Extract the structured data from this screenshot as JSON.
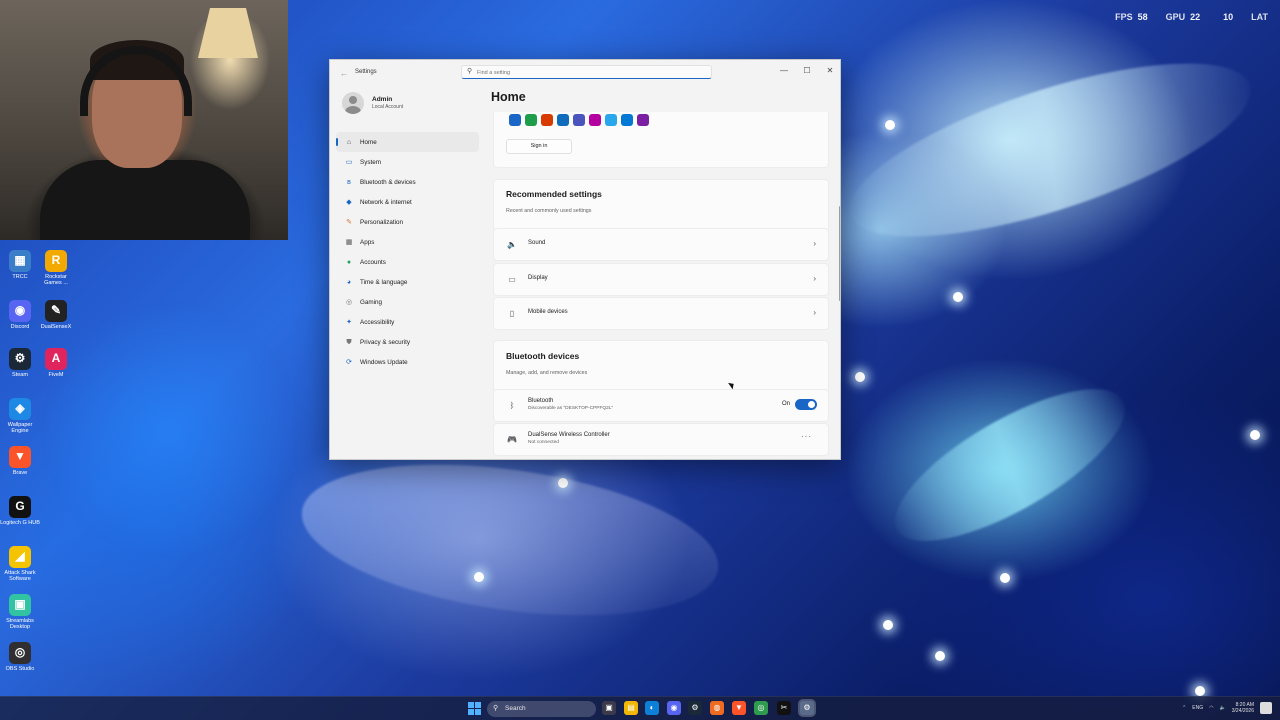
{
  "osd": {
    "fps_label": "FPS",
    "fps_value": "58",
    "gpu_label": "GPU",
    "gpu_value": "22",
    "cpu_value": "10",
    "lat_label": "LAT"
  },
  "desktop_icons": [
    {
      "name": "TRCC",
      "label": "TRCC",
      "color": "#3a7ec9",
      "glyph": "▦"
    },
    {
      "name": "rockstar",
      "label": "Rockstar Games ...",
      "color": "#f2a900",
      "glyph": "R"
    },
    {
      "name": "discord",
      "label": "Discord",
      "color": "#5865f2",
      "glyph": "◉"
    },
    {
      "name": "dualsensex",
      "label": "DualSenseX",
      "color": "#222222",
      "glyph": "✎"
    },
    {
      "name": "steam",
      "label": "Steam",
      "color": "#1b2838",
      "glyph": "⚙"
    },
    {
      "name": "fivem",
      "label": "FiveM",
      "color": "#e0245e",
      "glyph": "A"
    },
    {
      "name": "wallpaper-engine",
      "label": "Wallpaper Engine",
      "color": "#1e88e5",
      "glyph": "◈"
    },
    {
      "name": "brave",
      "label": "Brave",
      "color": "#fb542b",
      "glyph": "▼"
    },
    {
      "name": "logitech",
      "label": "Logitech G HUB",
      "color": "#111111",
      "glyph": "G"
    },
    {
      "name": "attack-shark",
      "label": "Attack Shark Software",
      "color": "#f5c400",
      "glyph": "◢"
    },
    {
      "name": "streamlabs",
      "label": "Streamlabs Desktop",
      "color": "#31c3a2",
      "glyph": "▣"
    },
    {
      "name": "obs",
      "label": "OBS Studio",
      "color": "#302e31",
      "glyph": "◎"
    }
  ],
  "window": {
    "app_title": "Settings",
    "search_placeholder": "Find a setting",
    "controls": {
      "minimize": "—",
      "maximize": "☐",
      "close": "✕"
    },
    "back": "←"
  },
  "profile": {
    "name": "Admin",
    "sub": "Local Account"
  },
  "nav": [
    {
      "label": "Home",
      "icon": "⌂",
      "color": "#444444",
      "active": true
    },
    {
      "label": "System",
      "icon": "▭",
      "color": "#1a66c6"
    },
    {
      "label": "Bluetooth & devices",
      "icon": "ʙ",
      "color": "#1a66c6"
    },
    {
      "label": "Network & internet",
      "icon": "◆",
      "color": "#1a66c6"
    },
    {
      "label": "Personalization",
      "icon": "✎",
      "color": "#d9702f"
    },
    {
      "label": "Apps",
      "icon": "▦",
      "color": "#555555"
    },
    {
      "label": "Accounts",
      "icon": "●",
      "color": "#2aa05a"
    },
    {
      "label": "Time & language",
      "icon": "◕",
      "color": "#1a66c6"
    },
    {
      "label": "Gaming",
      "icon": "◎",
      "color": "#777777"
    },
    {
      "label": "Accessibility",
      "icon": "✦",
      "color": "#1a66c6"
    },
    {
      "label": "Privacy & security",
      "icon": "⛊",
      "color": "#777777"
    },
    {
      "label": "Windows Update",
      "icon": "⟳",
      "color": "#1a66c6"
    }
  ],
  "main": {
    "title": "Home",
    "app_icon_colors": [
      "#1a66c6",
      "#1e9e4a",
      "#d83b01",
      "#0f6cbd",
      "#4b53bc",
      "#b4009e",
      "#28a8ea",
      "#0078d4",
      "#7b1fa2"
    ],
    "signin_label": "Sign in",
    "recommended": {
      "title": "Recommended settings",
      "sub": "Recent and commonly used settings",
      "items": [
        {
          "label": "Sound",
          "icon": "🔈"
        },
        {
          "label": "Display",
          "icon": "▭"
        },
        {
          "label": "Mobile devices",
          "icon": "▯"
        }
      ],
      "chevron": "›"
    },
    "bluetooth": {
      "title": "Bluetooth devices",
      "sub": "Manage, add, and remove devices",
      "bt_label": "Bluetooth",
      "bt_sub": "Discoverable as \"DESKTOP-CPPFQ2L\"",
      "bt_state": "On",
      "device_label": "DualSense Wireless Controller",
      "device_sub": "Not connected",
      "more": "···"
    }
  },
  "taskbar": {
    "search_label": "Search",
    "apps": [
      {
        "name": "task-view",
        "glyph": "▣",
        "color": "#3a3a4a"
      },
      {
        "name": "file-explorer",
        "glyph": "▤",
        "color": "#f2b705"
      },
      {
        "name": "edge",
        "glyph": "◐",
        "color": "#0c7fd6"
      },
      {
        "name": "discord",
        "glyph": "◉",
        "color": "#5865f2"
      },
      {
        "name": "steam",
        "glyph": "⚙",
        "color": "#1b2838"
      },
      {
        "name": "origin",
        "glyph": "◍",
        "color": "#f06b22"
      },
      {
        "name": "brave",
        "glyph": "▼",
        "color": "#fb542b"
      },
      {
        "name": "chrome",
        "glyph": "◎",
        "color": "#2e9b4f"
      },
      {
        "name": "capcut",
        "glyph": "✂",
        "color": "#111111"
      },
      {
        "name": "settings",
        "glyph": "⚙",
        "color": "#5b6c8a"
      }
    ],
    "tray_lang": "ENG",
    "time": "8:20 AM",
    "date": "3/24/2026"
  }
}
